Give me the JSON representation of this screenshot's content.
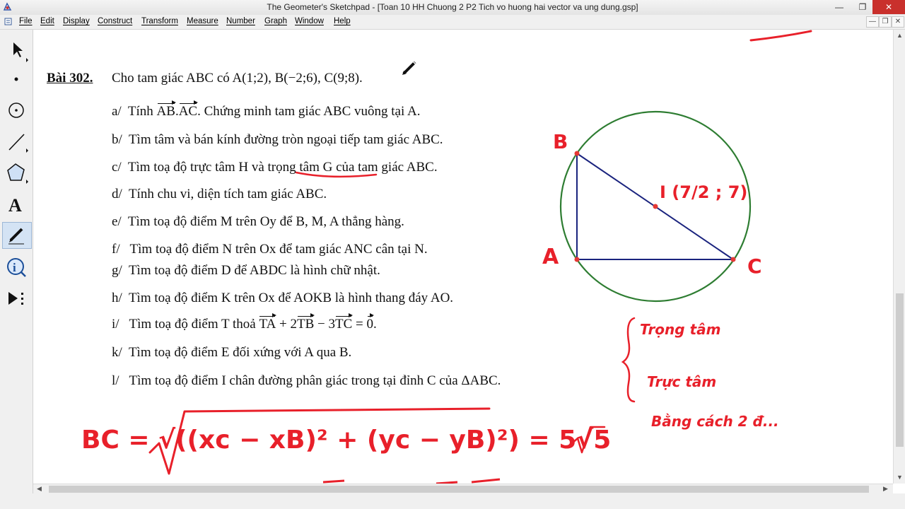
{
  "window": {
    "title": "The Geometer's Sketchpad - [Toan 10 HH Chuong 2 P2 Tich vo huong hai vector va ung dung.gsp]"
  },
  "menu": [
    "File",
    "Edit",
    "Display",
    "Construct",
    "Transform",
    "Measure",
    "Number",
    "Graph",
    "Window",
    "Help"
  ],
  "toolbox": [
    "arrow-select-tool",
    "point-tool",
    "compass-tool",
    "straightedge-tool",
    "polygon-tool",
    "text-tool",
    "marker-tool",
    "information-tool",
    "custom-tools"
  ],
  "problem": {
    "number": "Bài 302.",
    "intro": "Cho tam giác ABC có A(1;2), B(−2;6), C(9;8).",
    "items": [
      {
        "label": "a/",
        "pre": "Tính ",
        "vec1": "AB",
        "mid": ".",
        "vec2": "AC",
        "post": ". Chứng minh tam giác ABC vuông tại A."
      },
      {
        "label": "b/",
        "text": "Tìm tâm và bán kính đường tròn ngoại tiếp tam giác ABC."
      },
      {
        "label": "c/",
        "text": "Tìm toạ độ trực tâm H và trọng tâm G của tam giác ABC."
      },
      {
        "label": "d/",
        "text": "Tính chu vi, diện tích tam giác ABC."
      },
      {
        "label": "e/",
        "text": "Tìm toạ độ điểm M trên Oy để B, M, A thẳng hàng."
      },
      {
        "label": "f/",
        "text": "Tìm toạ độ điểm N trên Ox để tam giác ANC cân tại N."
      },
      {
        "label": "g/",
        "text": "Tìm toạ độ điểm D để ABDC là hình chữ nhật."
      },
      {
        "label": "h/",
        "text": "Tìm toạ độ điểm K trên Ox để AOKB là hình thang đáy AO."
      },
      {
        "label": "i/",
        "pre": "Tìm toạ độ điểm T thoả ",
        "v1": "TA",
        "t2": " + 2",
        "v2": "TB",
        "t3": " − 3",
        "v3": "TC",
        "t4": " = ",
        "v4": "0",
        "post": "."
      },
      {
        "label": "k/",
        "text": "Tìm toạ độ điểm E đối xứng với A qua B."
      },
      {
        "label": "l/",
        "text": "Tìm toạ độ điểm I chân đường phân giác trong tại đỉnh C của ΔABC."
      }
    ]
  },
  "handwriting": {
    "vertex_b": "B",
    "vertex_a": "A",
    "vertex_c": "C",
    "center_label": "I (7/2 ; 7)",
    "note1": "Trọng tâm",
    "note2": "Trực tâm",
    "note3": "Bằng cách 2 đ...",
    "formula": "BC = √((xc − xB)² + (yc − yB)²) = 5√5"
  },
  "colors": {
    "ink": "#e8202a",
    "circle": "#2e7d32",
    "triangle": "#1a237e",
    "point": "#e53935"
  }
}
